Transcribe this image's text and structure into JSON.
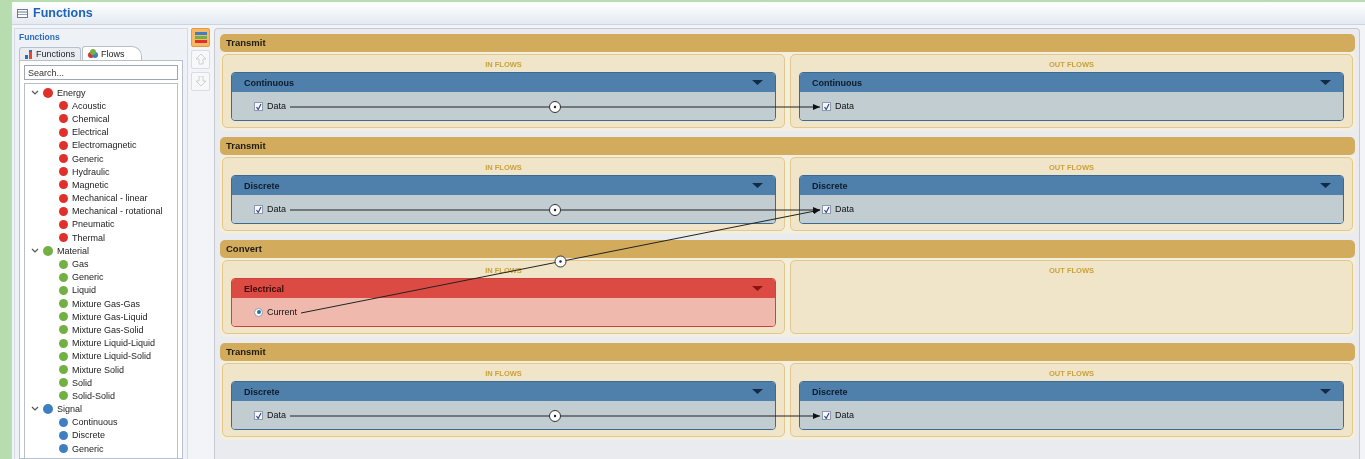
{
  "window": {
    "title": "Functions"
  },
  "sidebar": {
    "title": "Functions",
    "tabs": [
      {
        "label": "Functions",
        "kind": "functions",
        "selected": false
      },
      {
        "label": "Flows",
        "kind": "flows",
        "selected": true
      }
    ],
    "search": {
      "placeholder": "Search..."
    },
    "tree": [
      {
        "label": "Energy",
        "color": "#e0302a",
        "expanded": true,
        "children": [
          {
            "label": "Acoustic"
          },
          {
            "label": "Chemical"
          },
          {
            "label": "Electrical"
          },
          {
            "label": "Electromagnetic"
          },
          {
            "label": "Generic"
          },
          {
            "label": "Hydraulic"
          },
          {
            "label": "Magnetic"
          },
          {
            "label": "Mechanical - linear"
          },
          {
            "label": "Mechanical - rotational"
          },
          {
            "label": "Pneumatic"
          },
          {
            "label": "Thermal"
          }
        ]
      },
      {
        "label": "Material",
        "color": "#72b043",
        "expanded": true,
        "children": [
          {
            "label": "Gas"
          },
          {
            "label": "Generic"
          },
          {
            "label": "Liquid"
          },
          {
            "label": "Mixture Gas-Gas"
          },
          {
            "label": "Mixture Gas-Liquid"
          },
          {
            "label": "Mixture Gas-Solid"
          },
          {
            "label": "Mixture Liquid-Liquid"
          },
          {
            "label": "Mixture Liquid-Solid"
          },
          {
            "label": "Mixture Solid"
          },
          {
            "label": "Solid"
          },
          {
            "label": "Solid-Solid"
          }
        ]
      },
      {
        "label": "Signal",
        "color": "#3d7fc1",
        "expanded": true,
        "children": [
          {
            "label": "Continuous"
          },
          {
            "label": "Discrete"
          },
          {
            "label": "Generic"
          }
        ]
      }
    ]
  },
  "toolbar": [
    {
      "kind": "layout",
      "selected": true,
      "disabled": false
    },
    {
      "kind": "up",
      "selected": false,
      "disabled": true
    },
    {
      "kind": "down",
      "selected": false,
      "disabled": true
    }
  ],
  "blocks": [
    {
      "title": "Transmit",
      "in_flows": {
        "label": "IN FLOWS",
        "groups": [
          {
            "name": "Continuous",
            "kind": "signal",
            "items": [
              {
                "label": "Data",
                "kind": "checkbox",
                "checked": true,
                "connected": true,
                "to_previous_block": false
              }
            ]
          }
        ]
      },
      "out_flows": {
        "label": "OUT FLOWS",
        "groups": [
          {
            "name": "Continuous",
            "kind": "signal",
            "items": [
              {
                "label": "Data",
                "kind": "checkbox",
                "checked": true
              }
            ]
          }
        ]
      }
    },
    {
      "title": "Transmit",
      "in_flows": {
        "label": "IN FLOWS",
        "groups": [
          {
            "name": "Discrete",
            "kind": "signal",
            "items": [
              {
                "label": "Data",
                "kind": "checkbox",
                "checked": true,
                "connected": true,
                "to_previous_block": false
              }
            ]
          }
        ]
      },
      "out_flows": {
        "label": "OUT FLOWS",
        "groups": [
          {
            "name": "Discrete",
            "kind": "signal",
            "items": [
              {
                "label": "Data",
                "kind": "checkbox",
                "checked": true
              }
            ]
          }
        ]
      }
    },
    {
      "title": "Convert",
      "in_flows": {
        "label": "IN FLOWS",
        "groups": [
          {
            "name": "Electrical",
            "kind": "energy",
            "items": [
              {
                "label": "Current",
                "kind": "radio",
                "selected": true,
                "connected": true,
                "to_previous_block": true
              }
            ]
          }
        ]
      },
      "out_flows": {
        "label": "OUT FLOWS"
      }
    },
    {
      "title": "Transmit",
      "in_flows": {
        "label": "IN FLOWS",
        "groups": [
          {
            "name": "Discrete",
            "kind": "signal",
            "items": [
              {
                "label": "Data",
                "kind": "checkbox",
                "checked": true,
                "connected": true,
                "to_previous_block": false
              }
            ]
          }
        ]
      },
      "out_flows": {
        "label": "OUT FLOWS",
        "groups": [
          {
            "name": "Discrete",
            "kind": "signal",
            "items": [
              {
                "label": "Data",
                "kind": "checkbox",
                "checked": true
              }
            ]
          }
        ]
      }
    }
  ]
}
